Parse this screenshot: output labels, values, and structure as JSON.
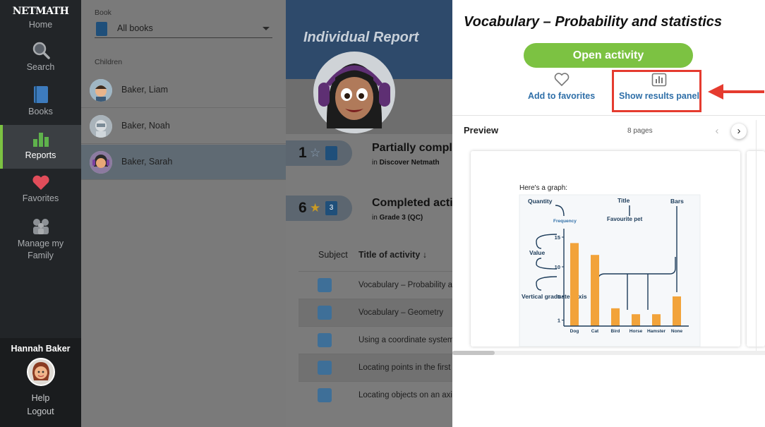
{
  "nav": {
    "logo": "NETMATH",
    "items": [
      {
        "label": "Home"
      },
      {
        "label": "Search"
      },
      {
        "label": "Books"
      },
      {
        "label": "Reports"
      },
      {
        "label": "Favorites"
      },
      {
        "label": "Manage my Family"
      }
    ],
    "user_name": "Hannah Baker",
    "help": "Help",
    "logout": "Logout",
    "active_color": "#7cc242"
  },
  "sidebar": {
    "book_label": "Book",
    "book_value": "All books",
    "children_label": "Children",
    "children": [
      {
        "name": "Baker, Liam"
      },
      {
        "name": "Baker, Noah"
      },
      {
        "name": "Baker, Sarah"
      }
    ]
  },
  "report": {
    "title": "Individual Report",
    "stats": [
      {
        "count": "1",
        "title": "Partially comple",
        "prefix": "in",
        "book": "Discover Netmath"
      },
      {
        "count": "6",
        "title": "Completed activ",
        "prefix": "in",
        "book": "Grade 3 (QC)",
        "book_badge": "3"
      }
    ],
    "columns": {
      "subject": "Subject",
      "title": "Title of activity ↓"
    },
    "activities": [
      {
        "title": "Vocabulary – Probability an"
      },
      {
        "title": "Vocabulary – Geometry"
      },
      {
        "title": "Using a coordinate system"
      },
      {
        "title": "Locating points in the first"
      },
      {
        "title": "Locating objects on an axis"
      }
    ]
  },
  "panel": {
    "title": "Vocabulary – Probability and statistics",
    "open_label": "Open activity",
    "favorites_label": "Add to favorites",
    "results_label": "Show results panel",
    "preview_label": "Preview",
    "pages": "8 pages",
    "highlight_color": "#e53b2f",
    "preview": {
      "intro": "Here's a graph:",
      "labels": {
        "quantity": "Quantity",
        "title": "Title",
        "bars": "Bars",
        "frequency": "Frequency",
        "fav_pet": "Favourite pet",
        "value": "Value",
        "axis": "Vertical graduated axis"
      },
      "chart_data": {
        "type": "bar",
        "categories": [
          "Dog",
          "Cat",
          "Bird",
          "Horse",
          "Hamster",
          "None"
        ],
        "values": [
          14,
          12,
          3,
          2,
          2,
          5
        ],
        "yticks": [
          1,
          5,
          10,
          15
        ],
        "ylim": [
          0,
          15
        ],
        "bar_color": "#f2a33a"
      }
    }
  }
}
